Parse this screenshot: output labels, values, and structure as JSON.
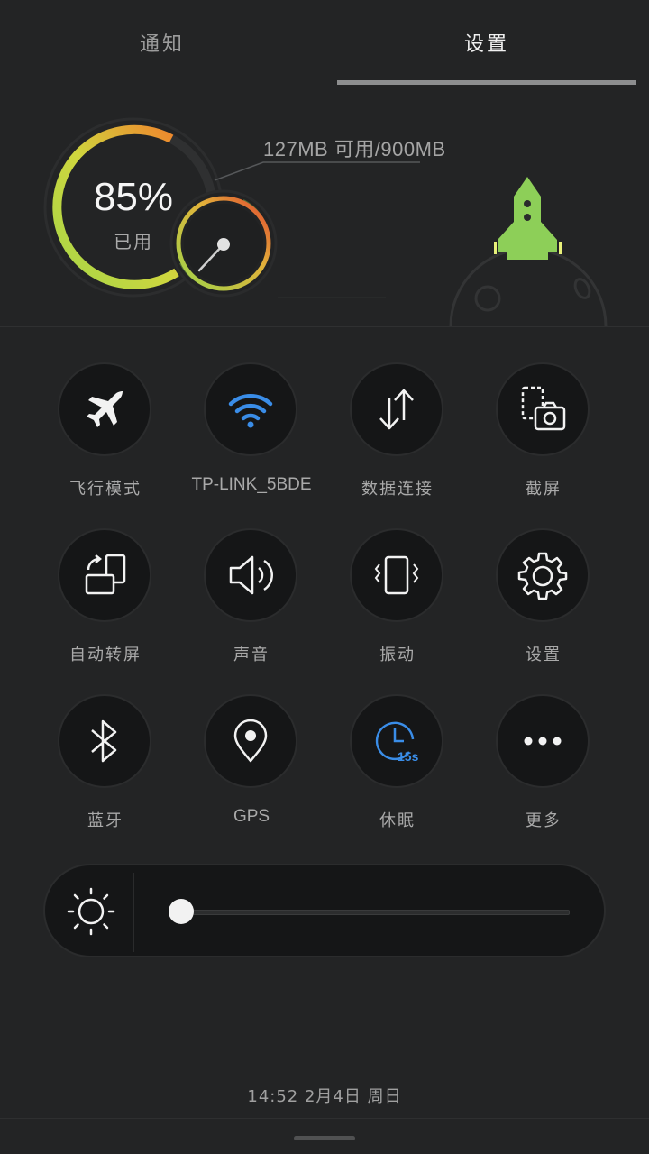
{
  "tabs": {
    "notifications": "通知",
    "settings": "设置",
    "active": "设置"
  },
  "memory": {
    "used_percent": "85%",
    "used_label": "已用",
    "available": "127MB 可用/900MB",
    "used_fraction": 0.85
  },
  "toggles": [
    {
      "label": "飞行模式",
      "icon": "airplane-icon",
      "active": false
    },
    {
      "label": "TP-LINK_5BDE",
      "icon": "wifi-icon",
      "active": true
    },
    {
      "label": "数据连接",
      "icon": "data-transfer-icon",
      "active": false
    },
    {
      "label": "截屏",
      "icon": "screenshot-icon",
      "active": false
    },
    {
      "label": "自动转屏",
      "icon": "auto-rotate-icon",
      "active": false
    },
    {
      "label": "声音",
      "icon": "sound-icon",
      "active": false
    },
    {
      "label": "振动",
      "icon": "vibrate-icon",
      "active": false
    },
    {
      "label": "设置",
      "icon": "gear-icon",
      "active": false
    },
    {
      "label": "蓝牙",
      "icon": "bluetooth-icon",
      "active": false
    },
    {
      "label": "GPS",
      "icon": "location-pin-icon",
      "active": false
    },
    {
      "label": "休眠",
      "icon": "sleep-timer-icon",
      "active": true,
      "badge": "15s"
    },
    {
      "label": "更多",
      "icon": "more-icon",
      "active": false
    }
  ],
  "brightness": {
    "level": 0.03,
    "icon": "sun-icon"
  },
  "datetime": "14:52 2月4日 周日",
  "colors": {
    "accent_blue": "#3a8de8",
    "rocket_green": "#8ccf58",
    "gauge_orange": "#f08a2b",
    "gauge_yellow": "#c8d43e"
  }
}
